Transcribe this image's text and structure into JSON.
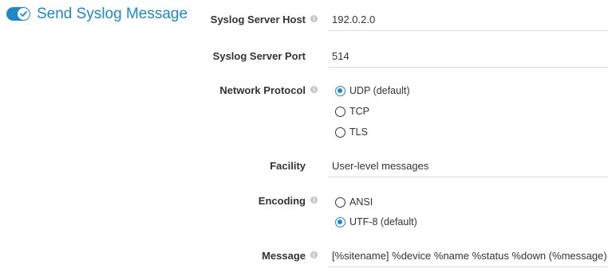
{
  "section": {
    "title": "Send Syslog Message",
    "enabled": true
  },
  "fields": {
    "host": {
      "label": "Syslog Server Host",
      "value": "192.0.2.0"
    },
    "port": {
      "label": "Syslog Server Port",
      "value": "514"
    },
    "protocol": {
      "label": "Network Protocol",
      "options": [
        "UDP (default)",
        "TCP",
        "TLS"
      ],
      "selected": "UDP (default)"
    },
    "facility": {
      "label": "Facility",
      "value": "User-level messages"
    },
    "encoding": {
      "label": "Encoding",
      "options": [
        "ANSI",
        "UTF-8 (default)"
      ],
      "selected": "UTF-8 (default)"
    },
    "message": {
      "label": "Message",
      "value": "[%sitename] %device %name %status %down (%message)"
    }
  },
  "icons": {
    "info": "info-icon",
    "toggle": "toggle-switch-on"
  },
  "colors": {
    "accent": "#1e88c7",
    "text": "#333333",
    "info_icon": "#c4c4c4",
    "divider": "#dcdcdc"
  }
}
